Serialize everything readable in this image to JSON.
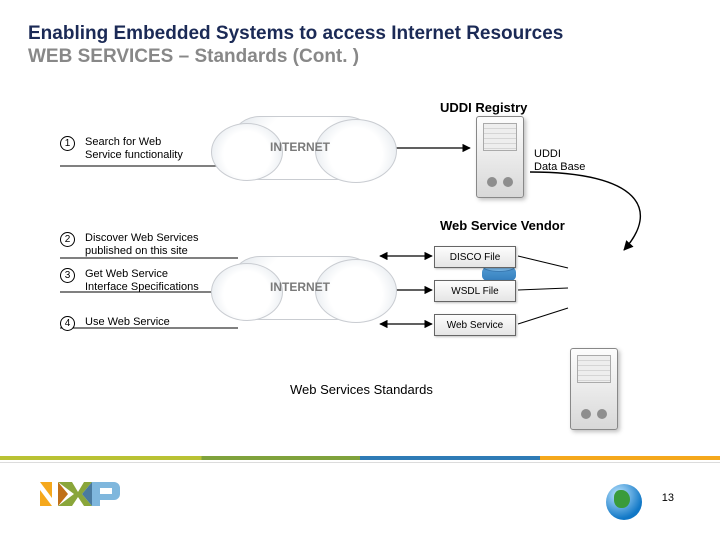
{
  "title_line1": "Enabling Embedded Systems to access Internet Resources",
  "subtitle": "WEB SERVICES – Standards (Cont. )",
  "headings": {
    "uddi_registry": "UDDI Registry",
    "web_service_vendor": "Web Service Vendor",
    "uddi_db": "UDDI\nData Base"
  },
  "steps": [
    {
      "num": "1",
      "text": "Search for Web\nService functionality"
    },
    {
      "num": "2",
      "text": "Discover Web Services\npublished on this site"
    },
    {
      "num": "3",
      "text": "Get Web Service\nInterface Specifications"
    },
    {
      "num": "4",
      "text": "Use Web Service"
    }
  ],
  "internet_label": "INTERNET",
  "fileboxes": {
    "disco": "DISCO File",
    "wsdl": "WSDL File",
    "ws": "Web Service"
  },
  "caption": "Web Services Standards",
  "page_number": "13",
  "logo_alt": "NXP"
}
